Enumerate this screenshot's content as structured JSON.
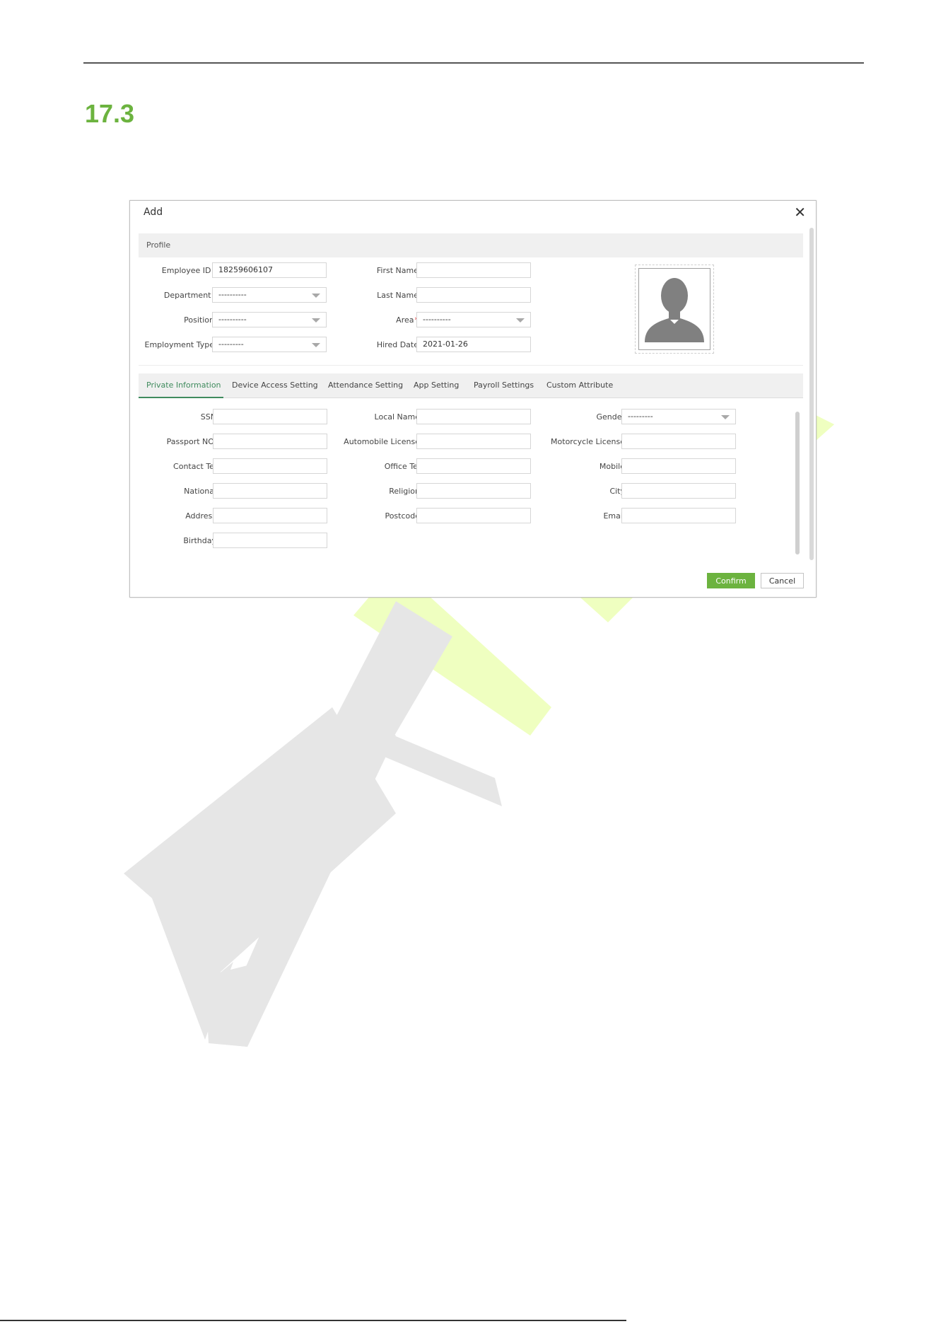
{
  "document": {
    "section_number": "17.3"
  },
  "dialog": {
    "title": "Add",
    "close_icon": "close-icon",
    "profile_header": "Profile",
    "profile": {
      "employee_id": {
        "label": "Employee ID",
        "value": "18259606107"
      },
      "department": {
        "label": "Department",
        "value": "----------"
      },
      "position": {
        "label": "Position",
        "value": "----------"
      },
      "employment_type": {
        "label": "Employment Type",
        "value": "---------"
      },
      "first_name": {
        "label": "First Name",
        "value": ""
      },
      "last_name": {
        "label": "Last Name",
        "value": ""
      },
      "area": {
        "label": "Area",
        "value": "----------"
      },
      "hired_date": {
        "label": "Hired Date",
        "value": "2021-01-26"
      },
      "required_mark": "*",
      "photo_icon": "person-silhouette-icon"
    },
    "tabs": [
      {
        "label": "Private Information",
        "active": true
      },
      {
        "label": "Device Access Setting",
        "active": false
      },
      {
        "label": "Attendance Setting",
        "active": false
      },
      {
        "label": "App Setting",
        "active": false
      },
      {
        "label": "Payroll Settings",
        "active": false
      },
      {
        "label": "Custom Attribute",
        "active": false
      }
    ],
    "private_info": {
      "ssn": {
        "label": "SSN",
        "value": ""
      },
      "passport": {
        "label": "Passport NO.",
        "value": ""
      },
      "contact_tel": {
        "label": "Contact Tel",
        "value": ""
      },
      "national": {
        "label": "National",
        "value": ""
      },
      "address": {
        "label": "Address",
        "value": ""
      },
      "birthday": {
        "label": "Birthday",
        "value": ""
      },
      "local_name": {
        "label": "Local Name",
        "value": ""
      },
      "automobile_license": {
        "label": "Automobile License",
        "value": ""
      },
      "office_tel": {
        "label": "Office Tel",
        "value": ""
      },
      "religion": {
        "label": "Religion",
        "value": ""
      },
      "postcode": {
        "label": "Postcode",
        "value": ""
      },
      "gender": {
        "label": "Gender",
        "value": "---------"
      },
      "motorcycle_license": {
        "label": "Motorcycle License",
        "value": ""
      },
      "mobile": {
        "label": "Mobile",
        "value": ""
      },
      "city": {
        "label": "City",
        "value": ""
      },
      "email": {
        "label": "Email",
        "value": ""
      }
    },
    "buttons": {
      "confirm": "Confirm",
      "cancel": "Cancel"
    }
  },
  "colors": {
    "brand_green": "#6cb33f",
    "active_tab": "#3f8b5d",
    "required": "#e02020",
    "watermark_gray": "#e6e6e6",
    "watermark_yellow": "#efffc0"
  }
}
